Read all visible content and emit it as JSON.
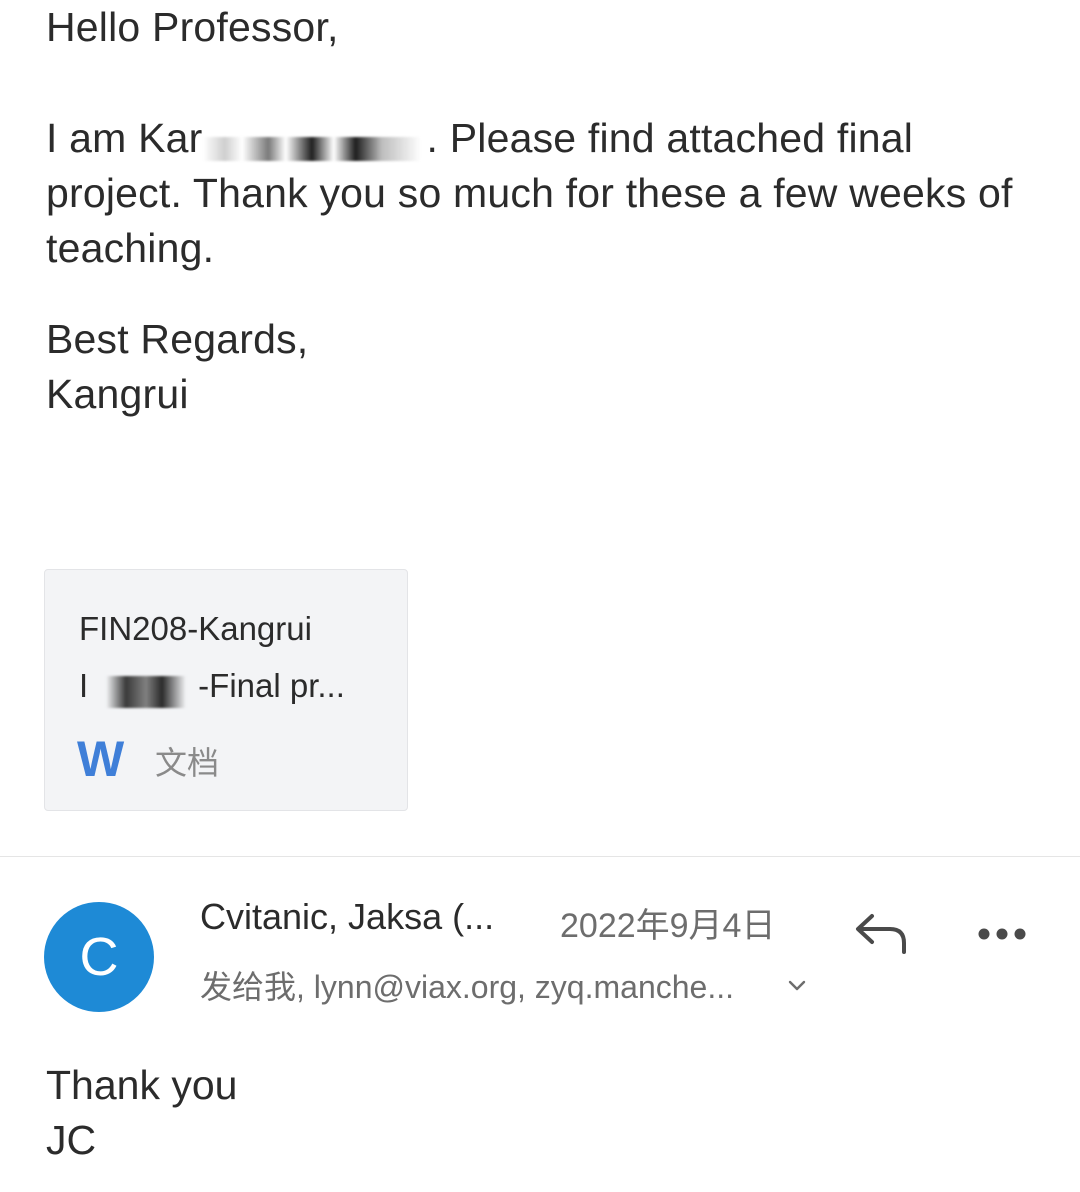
{
  "message1": {
    "greeting": "Hello Professor,",
    "intro_prefix": "I am Kar",
    "intro_rest": ". Please find attached final project. Thank you so much for these a few weeks of teaching.",
    "closing": "Best Regards,",
    "signature": "Kangrui"
  },
  "attachment": {
    "name_line1": "FIN208-Kangrui",
    "name_line2_prefix": "I",
    "name_line2_suffix": "-Final pr...",
    "file_type_letter": "W",
    "file_type_label": "文档",
    "icon_color": "#3f7fd8"
  },
  "reply": {
    "avatar_letter": "C",
    "avatar_color": "#1e8ad6",
    "sender": "Cvitanic, Jaksa (...",
    "date": "2022年9月4日",
    "recipients": "发给我, lynn@viax.org, zyq.manche...",
    "body_line1": "Thank you",
    "body_line2": "JC"
  },
  "icons": {
    "reply": "reply-arrow-icon",
    "more": "more-horizontal-icon",
    "expand": "chevron-down-icon",
    "file": "word-doc-icon"
  }
}
